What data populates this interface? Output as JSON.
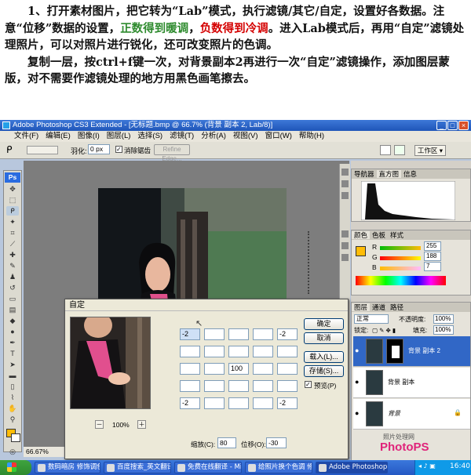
{
  "tutorial": {
    "p1_a": "1、打开素材图片，把它转为“Lab”模式，执行滤镜/其它/自定，设置好各数据。注意“位移”数据的设置，",
    "p1_pos_warm": "正数得到暖调",
    "p1_sep": "，",
    "p1_neg_cool": "负数得到冷调",
    "p1_b": "。进入Lab模式后，再用“自定”滤镜处理照片，可以对照片进行锐化，还可改变照片的色调。",
    "p2": "复制一层，按ctrl+f键一次，对背景副本2再进行一次“自定”滤镜操作，添加图层蒙版，对不需要作滤镜处理的地方用黑色画笔擦去。"
  },
  "window": {
    "title": "Adobe Photoshop CS3 Extended - [无标题.bmp @ 66.7% (背景 副本 2, Lab/8)]",
    "min": "_",
    "max": "□",
    "close": "×"
  },
  "menu": [
    "文件(F)",
    "编辑(E)",
    "图像(I)",
    "图层(L)",
    "选择(S)",
    "滤镜(T)",
    "分析(A)",
    "视图(V)",
    "窗口(W)",
    "帮助(H)"
  ],
  "options": {
    "feather_label": "羽化:",
    "feather_value": "0 px",
    "antialias": "消除锯齿",
    "refine_edge": "Refine Edge...",
    "workspace": "工作区 ▾"
  },
  "tools": {
    "ps_logo": "Ps"
  },
  "status": {
    "zoom": "66.67%"
  },
  "panels": {
    "tabs_top": [
      "导航器",
      "直方图",
      "信息"
    ],
    "tabs_color": [
      "颜色",
      "色板",
      "样式"
    ],
    "color_labels": [
      "R",
      "G",
      "B"
    ],
    "color_values": [
      "255",
      "188",
      "7"
    ],
    "tabs_layers": [
      "图层",
      "通道",
      "路径"
    ],
    "blend_mode": "正常",
    "opacity_label": "不透明度:",
    "opacity_value": "100%",
    "lock_label": "锁定:",
    "fill_label": "填充:",
    "fill_value": "100%",
    "layers": [
      "背景 副本 2",
      "背景 副本",
      "背景"
    ],
    "watermark": "照片处理网",
    "watermark_logo": "PhotoPS"
  },
  "dialog": {
    "title": "自定",
    "grid": [
      "-2",
      "",
      "",
      "",
      "-2",
      "",
      "",
      "",
      "",
      "",
      "",
      "",
      "100",
      "",
      "",
      "",
      "",
      "",
      "",
      "",
      "-2",
      "",
      "",
      "",
      "-2"
    ],
    "ok": "确定",
    "cancel": "取消",
    "load": "载入(L)...",
    "save": "存储(S)...",
    "preview": "预览(P)",
    "scale_label": "缩放(C):",
    "scale_value": "80",
    "offset_label": "位移(O):",
    "offset_value": "-30",
    "zoom_value": "100%",
    "zoom_minus": "－",
    "zoom_plus": "＋"
  },
  "taskbar": {
    "items": [
      "数码暗房 修饰调色",
      "百度搜索_英文翻译...",
      "免费在线翻译 - Micr...",
      "给照片换个色调 修...",
      "Adobe Photoshop CS..."
    ],
    "clock": "16:40"
  }
}
